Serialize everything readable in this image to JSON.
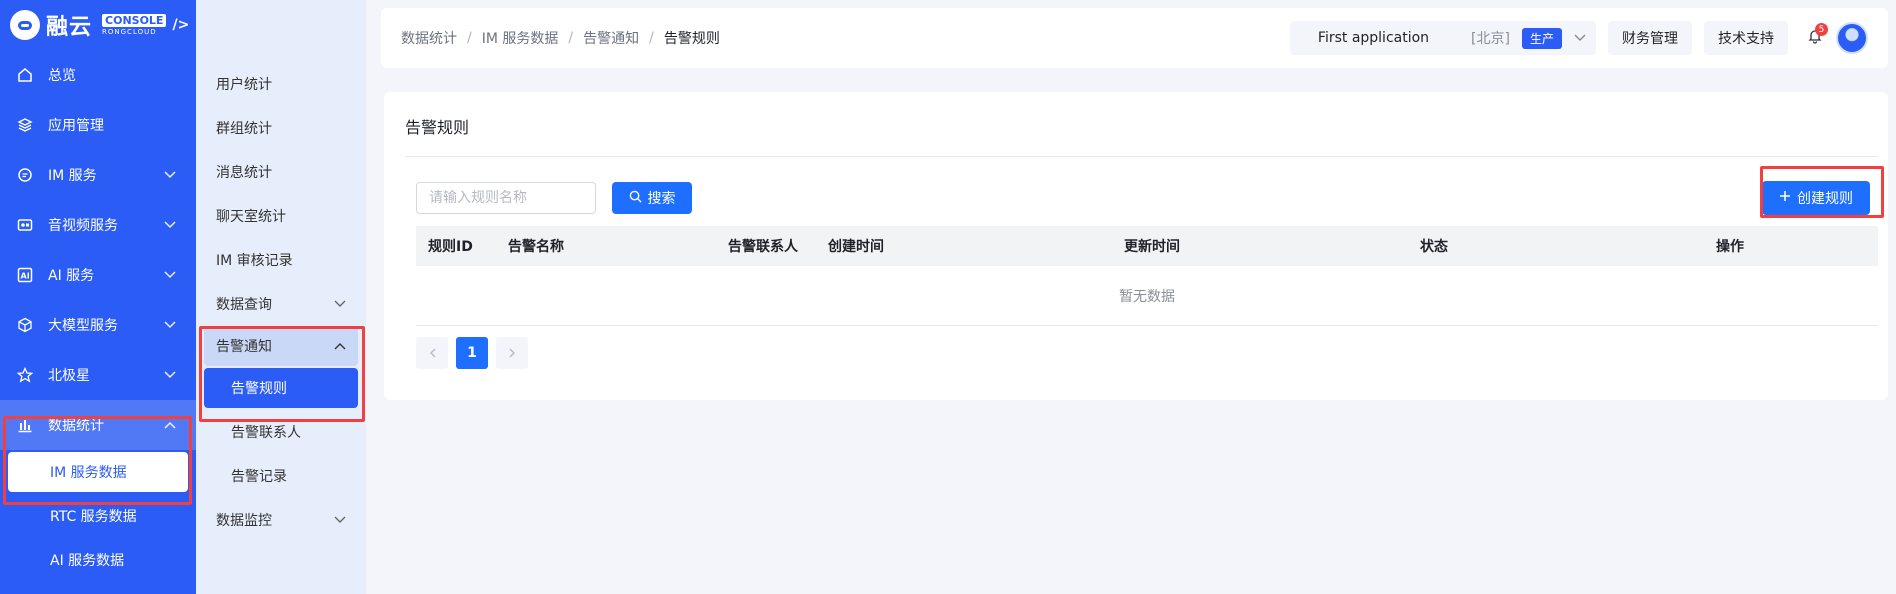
{
  "brand": {
    "name": "融云",
    "console": "CONSOLE",
    "sub": "RONGCLOUD",
    "arrow": "/>"
  },
  "sidebar": {
    "items": [
      {
        "label": "总览",
        "icon": "home-icon"
      },
      {
        "label": "应用管理",
        "icon": "layers-icon"
      },
      {
        "label": "IM 服务",
        "icon": "chat-icon"
      },
      {
        "label": "音视频服务",
        "icon": "video-icon"
      },
      {
        "label": "AI 服务",
        "icon": "ai-icon"
      },
      {
        "label": "大模型服务",
        "icon": "cube-icon"
      },
      {
        "label": "北极星",
        "icon": "star-icon"
      },
      {
        "label": "数据统计",
        "icon": "bar-chart-icon"
      }
    ],
    "sub_items": [
      {
        "label": "IM 服务数据"
      },
      {
        "label": "RTC 服务数据"
      },
      {
        "label": "AI 服务数据"
      }
    ]
  },
  "subnav": {
    "items": [
      {
        "label": "用户统计"
      },
      {
        "label": "群组统计"
      },
      {
        "label": "消息统计"
      },
      {
        "label": "聊天室统计"
      },
      {
        "label": "IM 审核记录"
      },
      {
        "label": "数据查询"
      },
      {
        "label": "告警通知"
      },
      {
        "label": "告警规则"
      },
      {
        "label": "告警联系人"
      },
      {
        "label": "告警记录"
      },
      {
        "label": "数据监控"
      }
    ]
  },
  "breadcrumb": [
    "数据统计",
    "IM 服务数据",
    "告警通知",
    "告警规则"
  ],
  "header": {
    "app_name": "First application",
    "region": "[北京]",
    "env": "生产",
    "finance": "财务管理",
    "support": "技术支持",
    "notif_count": "5"
  },
  "main": {
    "title": "告警规则",
    "search_placeholder": "请输入规则名称",
    "search_label": "搜索",
    "create_label": "创建规则",
    "columns": [
      "规则ID",
      "告警名称",
      "告警联系人",
      "创建时间",
      "更新时间",
      "状态",
      "操作"
    ],
    "empty_text": "暂无数据",
    "page": "1"
  },
  "colors": {
    "accent": "#1e6fff",
    "sidebar": "#2b5cf5",
    "highlight": "#f24040"
  }
}
